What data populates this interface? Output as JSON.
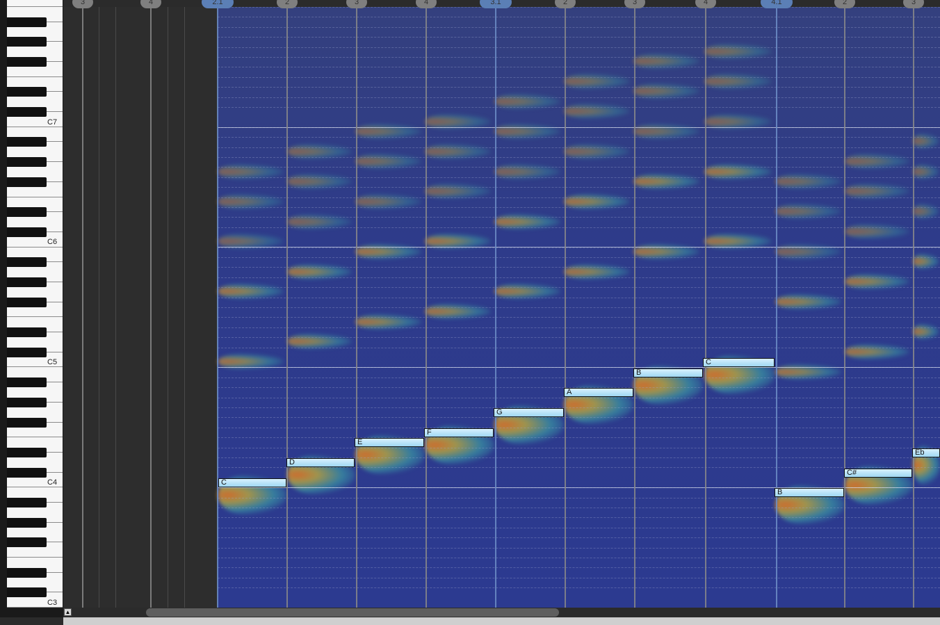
{
  "keyboard": {
    "labels": [
      "C7",
      "C6",
      "C5",
      "C4",
      "C3"
    ]
  },
  "ruler": {
    "markers": [
      "3",
      "4",
      "2.1",
      "2",
      "3",
      "4",
      "3.1",
      "2",
      "3",
      "4",
      "4.1",
      "2",
      "3"
    ]
  },
  "notes": [
    "C",
    "D",
    "E",
    "F",
    "G",
    "A",
    "B",
    "C",
    "B",
    "C#",
    "Eb"
  ],
  "scroll": {
    "corner_icon": "▲"
  },
  "colors": {
    "spectrogram_bg": "#2e3b8a",
    "note_fill": "#b5e2f7",
    "accent": "#5b7fb6"
  }
}
